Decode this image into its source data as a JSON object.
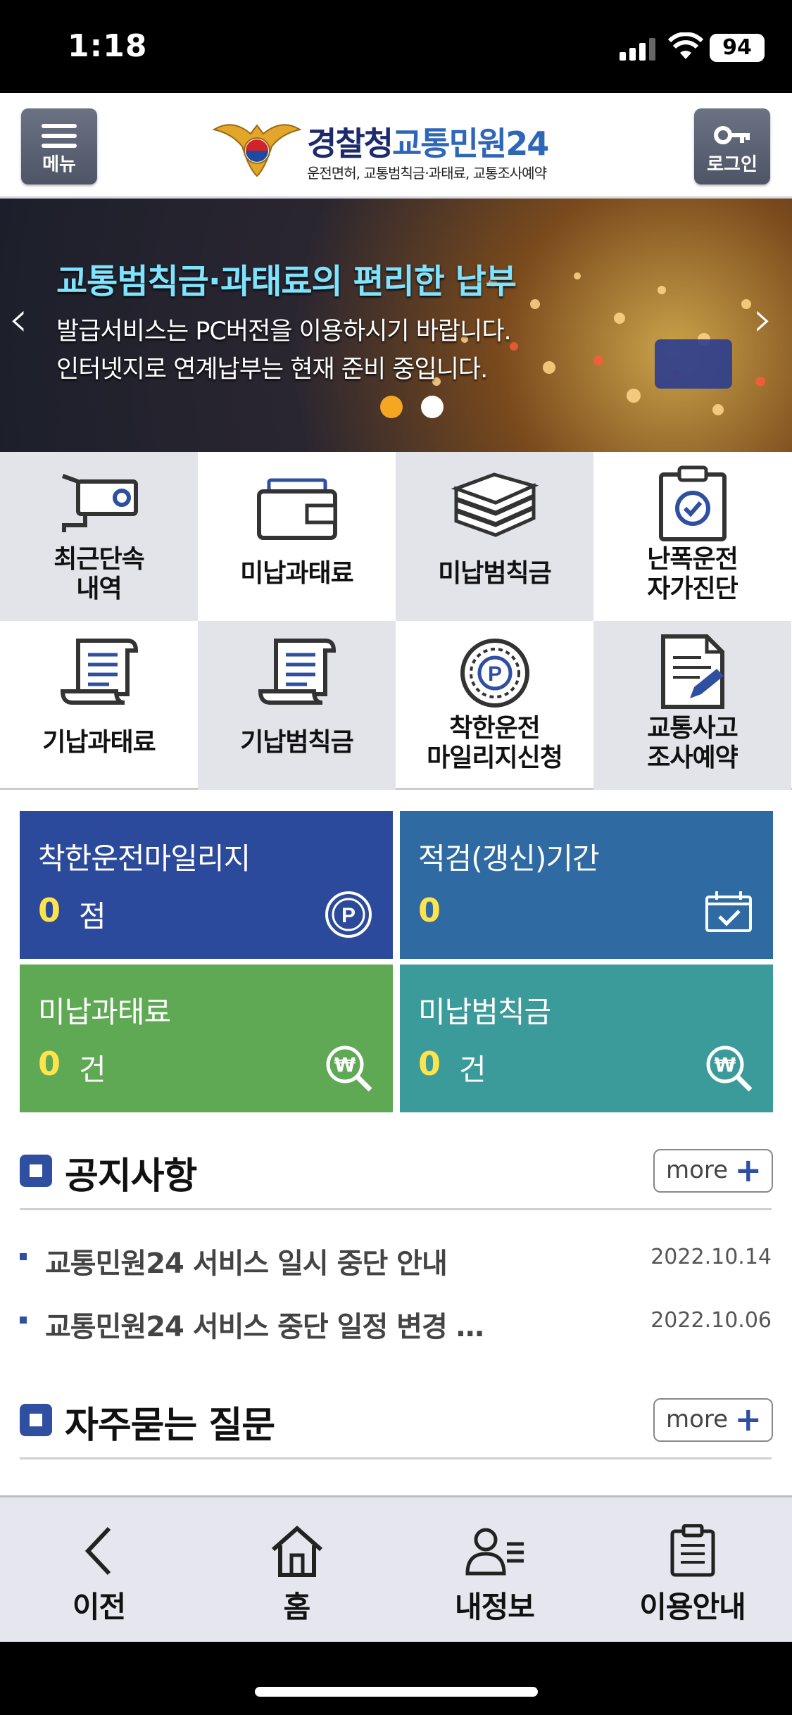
{
  "status_bar": {
    "time": "1:18",
    "battery": "94"
  },
  "header": {
    "menu_label": "메뉴",
    "login_label": "로그인",
    "logo_agency": "경찰청",
    "logo_service": "교통민원24",
    "logo_subtitle": "운전면허, 교통범칙금·과태료, 교통조사예약"
  },
  "banner": {
    "headline": "교통범칙금·과태료의 편리한 납부",
    "line1": "발급서비스는 PC버전을 이용하시기 바랍니다.",
    "line2": "인터넷지로 연계납부는 현재 준비 중입니다.",
    "active_dot_color": "#f5a623"
  },
  "menu_grid": [
    {
      "label": "최근단속\n내역",
      "icon": "camera-icon"
    },
    {
      "label": "미납과태료",
      "icon": "wallet-icon"
    },
    {
      "label": "미납범칙금",
      "icon": "money-stack-icon"
    },
    {
      "label": "난폭운전\n자가진단",
      "icon": "clipboard-check-icon"
    },
    {
      "label": "기납과태료",
      "icon": "scroll-icon"
    },
    {
      "label": "기납범칙금",
      "icon": "scroll-icon"
    },
    {
      "label": "착한운전\n마일리지신청",
      "icon": "parking-coin-icon"
    },
    {
      "label": "교통사고\n조사예약",
      "icon": "document-pen-icon"
    }
  ],
  "tiles": [
    {
      "title": "착한운전마일리지",
      "value": "0",
      "unit": "점",
      "color": "#2c4a9c",
      "icon": "mileage-p-icon"
    },
    {
      "title": "적검(갱신)기간",
      "value": "0",
      "unit": "",
      "color": "#2f6aa3",
      "icon": "calendar-check-icon"
    },
    {
      "title": "미납과태료",
      "value": "0",
      "unit": "건",
      "color": "#5fa854",
      "icon": "won-search-icon"
    },
    {
      "title": "미납범칙금",
      "value": "0",
      "unit": "건",
      "color": "#3b9a9a",
      "icon": "won-search-icon"
    }
  ],
  "notices": {
    "title": "공지사항",
    "more_label": "more",
    "items": [
      {
        "text": "교통민원24 서비스 일시 중단 안내",
        "date": "2022.10.14"
      },
      {
        "text": "교통민원24 서비스 중단 일정 변경 …",
        "date": "2022.10.06"
      }
    ]
  },
  "faq": {
    "title": "자주묻는 질문",
    "more_label": "more"
  },
  "tab_bar": [
    {
      "label": "이전",
      "icon": "back-chevron-icon"
    },
    {
      "label": "홈",
      "icon": "home-icon"
    },
    {
      "label": "내정보",
      "icon": "user-list-icon"
    },
    {
      "label": "이용안내",
      "icon": "clipboard-icon"
    }
  ]
}
